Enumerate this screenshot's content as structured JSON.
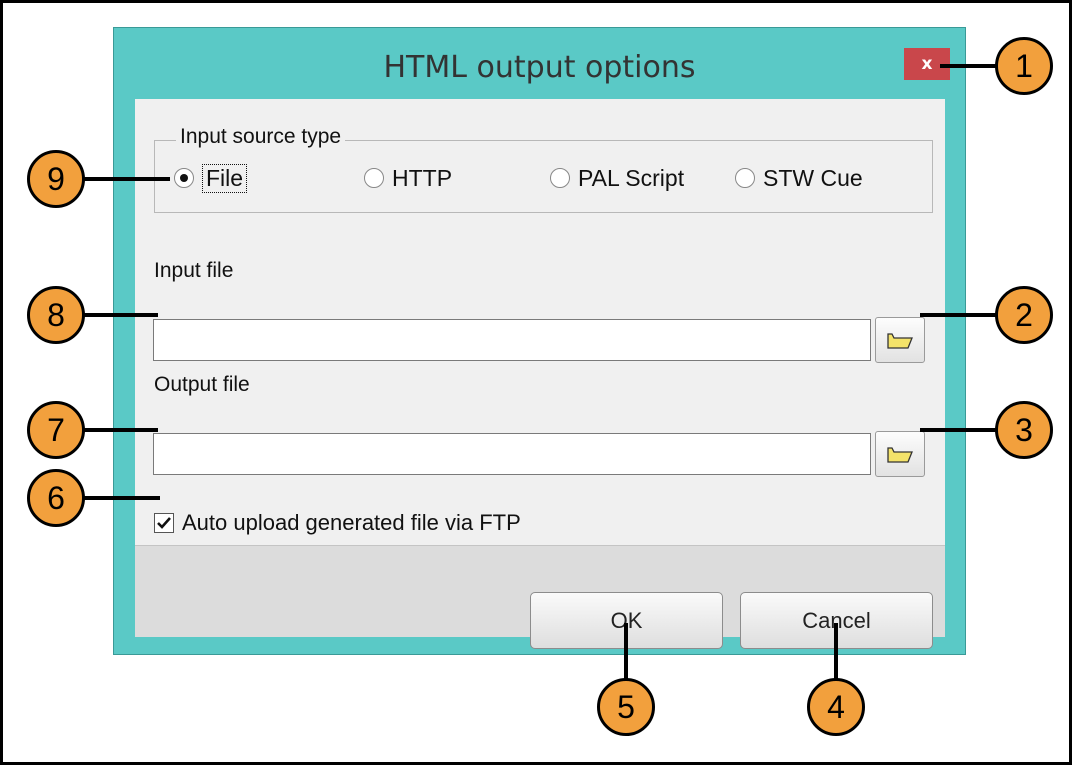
{
  "dialog": {
    "title": "HTML output options",
    "close_label": "x",
    "source_group": {
      "label": "Input source type",
      "options": [
        "File",
        "HTTP",
        "PAL Script",
        "STW Cue"
      ],
      "selected": "File"
    },
    "input_file": {
      "label": "Input file",
      "value": ""
    },
    "output_file": {
      "label": "Output file",
      "value": ""
    },
    "auto_upload": {
      "label": "Auto upload generated file via FTP",
      "checked": true
    },
    "ok_label": "OK",
    "cancel_label": "Cancel"
  },
  "callouts": [
    "1",
    "2",
    "3",
    "4",
    "5",
    "6",
    "7",
    "8",
    "9"
  ],
  "colors": {
    "window": "#5ac9c6",
    "close": "#c9474b",
    "callout": "#f2a03d",
    "folder_icon": "#f4e36a"
  }
}
